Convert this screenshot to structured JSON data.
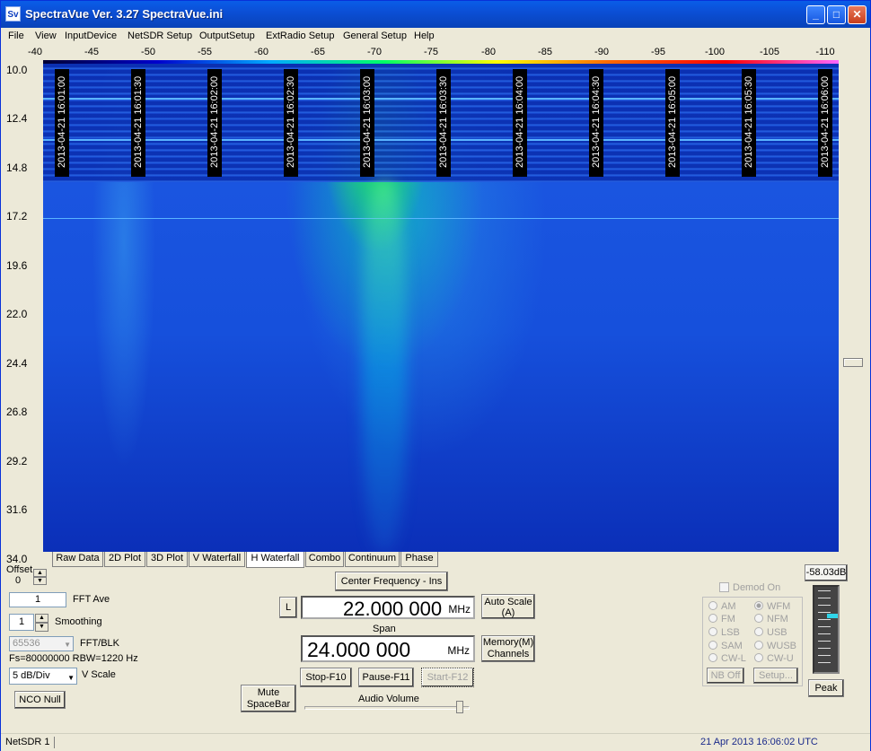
{
  "window": {
    "title": "SpectraVue Ver. 3.27  SpectraVue.ini",
    "icon_text": "Sv",
    "buttons": {
      "minimize": "_",
      "maximize": "□",
      "close": "✕"
    }
  },
  "menu": [
    "File",
    "View",
    "InputDevice",
    "NetSDR Setup",
    "OutputSetup",
    "ExtRadio Setup",
    "General Setup",
    "Help"
  ],
  "freq_scale": [
    "-40",
    "-45",
    "-50",
    "-55",
    "-60",
    "-65",
    "-70",
    "-75",
    "-80",
    "-85",
    "-90",
    "-95",
    "-100",
    "-105",
    "-110"
  ],
  "y_axis": [
    "10.0",
    "12.4",
    "14.8",
    "17.2",
    "19.6",
    "22.0",
    "24.4",
    "26.8",
    "29.2",
    "31.6",
    "34.0"
  ],
  "timestamps": [
    "2013-04-21 16:01:00",
    "2013-04-21 16:01:30",
    "2013-04-21 16:02:00",
    "2013-04-21 16:02:30",
    "2013-04-21 16:03:00",
    "2013-04-21 16:03:30",
    "2013-04-21 16:04:00",
    "2013-04-21 16:04:30",
    "2013-04-21 16:05:00",
    "2013-04-21 16:05:30",
    "2013-04-21 16:06:00"
  ],
  "tabs": [
    "Raw Data",
    "2D Plot",
    "3D Plot",
    "V Waterfall",
    "H Waterfall",
    "Combo",
    "Continuum",
    "Phase"
  ],
  "active_tab": "H Waterfall",
  "controls": {
    "offset_label": "Offset",
    "offset_value": "0",
    "fft_ave_value": "1",
    "fft_ave_label": "FFT Ave",
    "smoothing_value": "1",
    "smoothing_label": "Smoothing",
    "fft_blk_value": "65536",
    "fft_blk_label": "FFT/BLK",
    "fs_info": "Fs=80000000 RBW=1220 Hz",
    "vscale_value": "5 dB/Div",
    "vscale_label": "V Scale",
    "nco_null": "NCO Null",
    "center_freq_button": "Center Frequency - Ins",
    "l_button": "L",
    "center_freq_value": "22.000 000",
    "center_freq_unit": "MHz",
    "auto_scale": "Auto Scale (A)",
    "span_label": "Span",
    "span_value": "24.000 000",
    "span_unit": "MHz",
    "memory_channels": "Memory(M) Channels",
    "stop": "Stop-F10",
    "pause": "Pause-F11",
    "start": "Start-F12",
    "mute": "Mute SpaceBar",
    "audio_volume": "Audio Volume",
    "demod_on": "Demod On",
    "modes_left": [
      "AM",
      "FM",
      "LSB",
      "SAM",
      "CW-L"
    ],
    "modes_right": [
      "WFM",
      "NFM",
      "USB",
      "WUSB",
      "CW-U"
    ],
    "selected_mode": "WFM",
    "nb_off": "NB Off",
    "setup": "Setup...",
    "peak_db": "-58.03dB",
    "peak_button": "Peak"
  },
  "status": {
    "device": "NetSDR 1",
    "datetime": "21 Apr 2013   16:06:02 UTC"
  }
}
